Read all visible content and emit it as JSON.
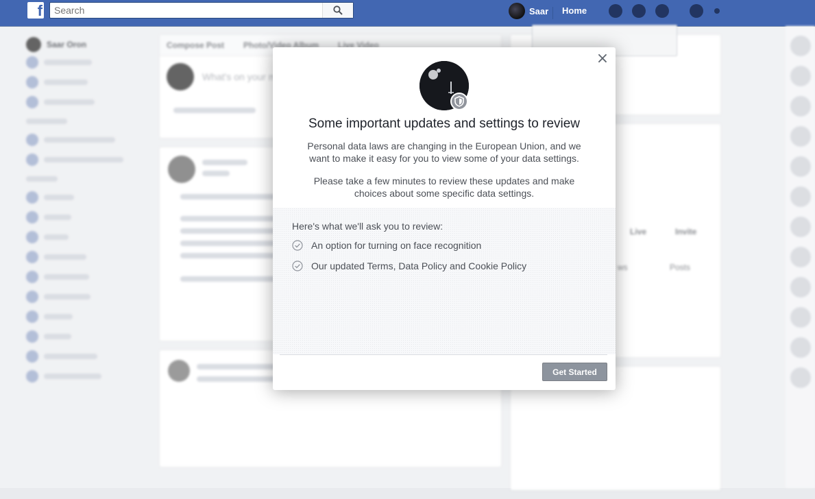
{
  "topbar": {
    "logo": "f",
    "search_placeholder": "Search",
    "user_name": "Saar",
    "home_label": "Home"
  },
  "background": {
    "left_nav_user": "Saar Oron",
    "compose_tabs": [
      "Compose Post",
      "Photo/Video Album",
      "Live Video"
    ],
    "compose_prompt": "What's on your mind?",
    "right_actions": [
      "Live",
      "Invite"
    ],
    "right_tabs": [
      "ws",
      "Posts"
    ]
  },
  "modal": {
    "title": "Some important updates and settings to review",
    "paragraph1": "Personal data laws are changing in the European Union, and we want to make it easy for you to view some of your data settings.",
    "paragraph2": "Please take a few minutes to review these updates and make choices about some specific data settings.",
    "review_heading": "Here's what we'll ask you to review:",
    "review_items": [
      "An option for turning on face recognition",
      "Our updated Terms, Data Policy and Cookie Policy"
    ],
    "button_label": "Get Started",
    "close_symbol": "×"
  },
  "colors": {
    "brand_blue": "#4267b2",
    "button_gray": "#8d949e",
    "shield_gray": "#90949c"
  }
}
